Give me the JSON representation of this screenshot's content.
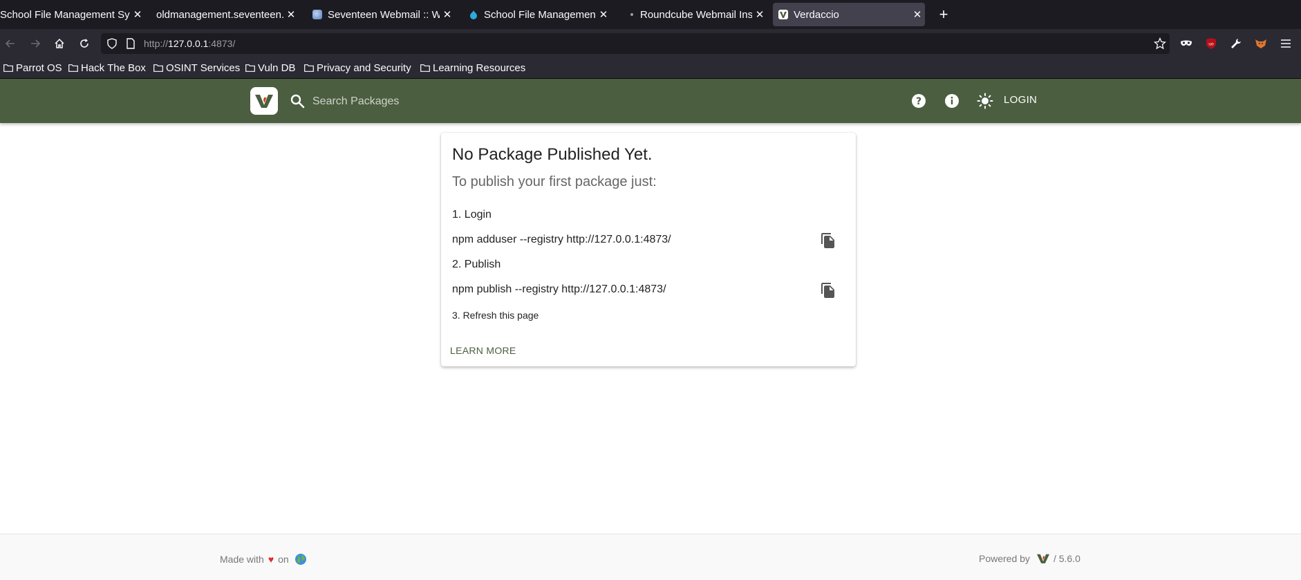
{
  "browser": {
    "tabs": [
      {
        "title": "School File Management Sys",
        "active": false
      },
      {
        "title": "oldmanagement.seventeen.",
        "active": false
      },
      {
        "title": "Seventeen Webmail :: We",
        "active": false
      },
      {
        "title": "School File Management",
        "active": false
      },
      {
        "title": "Roundcube Webmail Inst",
        "active": false
      },
      {
        "title": "Verdaccio",
        "active": true
      }
    ],
    "url": {
      "scheme": "http://",
      "host": "127.0.0.1",
      "rest": ":4873/"
    },
    "bookmarks": [
      "Parrot OS",
      "Hack The Box",
      "OSINT Services",
      "Vuln DB",
      "Privacy and Security",
      "Learning Resources"
    ]
  },
  "header": {
    "search_placeholder": "Search Packages",
    "login_label": "LOGIN",
    "color": "#4b5e40"
  },
  "card": {
    "title": "No Package Published Yet.",
    "subtitle": "To publish your first package just:",
    "step1": "1. Login",
    "cmd1": "npm adduser --registry http://127.0.0.1:4873/",
    "step2": "2. Publish",
    "cmd2": "npm publish --registry http://127.0.0.1:4873/",
    "step3": "3. Refresh this page",
    "learn_more": "LEARN MORE"
  },
  "footer": {
    "made_with": "Made with",
    "heart": "♥",
    "on": "on",
    "powered_by": "Powered by",
    "version": "/ 5.6.0"
  },
  "icons": {
    "tab_favicons": [
      "none",
      "none",
      "webmail-icon",
      "drupal-icon",
      "dot-icon",
      "verdaccio-icon"
    ],
    "header": [
      "search-icon",
      "help-icon",
      "info-icon",
      "theme-toggle-icon"
    ],
    "copy": "copy-icon"
  }
}
